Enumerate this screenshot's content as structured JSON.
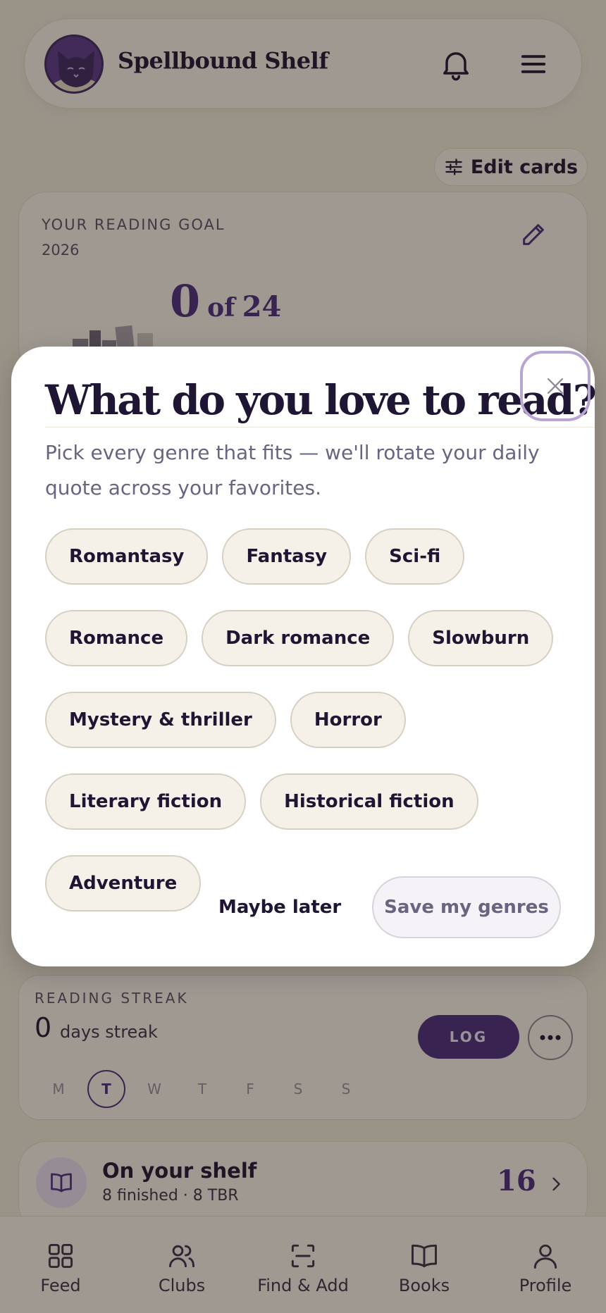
{
  "app": {
    "title": "Spellbound Shelf"
  },
  "header": {
    "notifications_icon": "bell-icon",
    "menu_icon": "hamburger-menu-icon"
  },
  "edit_cards": {
    "label": "Edit cards",
    "icon": "sliders-icon"
  },
  "goal": {
    "label": "YOUR READING GOAL",
    "year": "2026",
    "current": "0",
    "of_label": "of",
    "target": "24",
    "edit_icon": "pencil-icon"
  },
  "streak": {
    "label": "READING STREAK",
    "count": "0",
    "unit": "days streak",
    "log_label": "LOG",
    "more_icon": "more-horizontal-icon",
    "days": [
      "M",
      "T",
      "W",
      "T",
      "F",
      "S",
      "S"
    ],
    "today_index": 1
  },
  "shelf": {
    "title": "On your shelf",
    "subtitle": "8 finished · 8 TBR",
    "count": "16",
    "icon": "open-book-icon"
  },
  "nav": {
    "items": [
      {
        "label": "Feed",
        "icon": "grid-icon"
      },
      {
        "label": "Clubs",
        "icon": "users-icon"
      },
      {
        "label": "Find & Add",
        "icon": "scan-icon"
      },
      {
        "label": "Books",
        "icon": "book-icon"
      },
      {
        "label": "Profile",
        "icon": "user-icon"
      }
    ]
  },
  "modal": {
    "title": "What do you love to read?",
    "subtitle": "Pick every genre that fits — we'll rotate your daily quote across your favorites.",
    "close_icon": "close-icon",
    "genres": [
      "Romantasy",
      "Fantasy",
      "Sci-fi",
      "Romance",
      "Dark romance",
      "Slowburn",
      "Mystery & thriller",
      "Horror",
      "Literary fiction",
      "Historical fiction",
      "Adventure"
    ],
    "maybe_later_label": "Maybe later",
    "save_label": "Save my genres"
  },
  "colors": {
    "accent": "#4c2c7c",
    "background": "#f3ecdd",
    "card": "#fbf7ee",
    "chip": "#f6f1e8"
  }
}
